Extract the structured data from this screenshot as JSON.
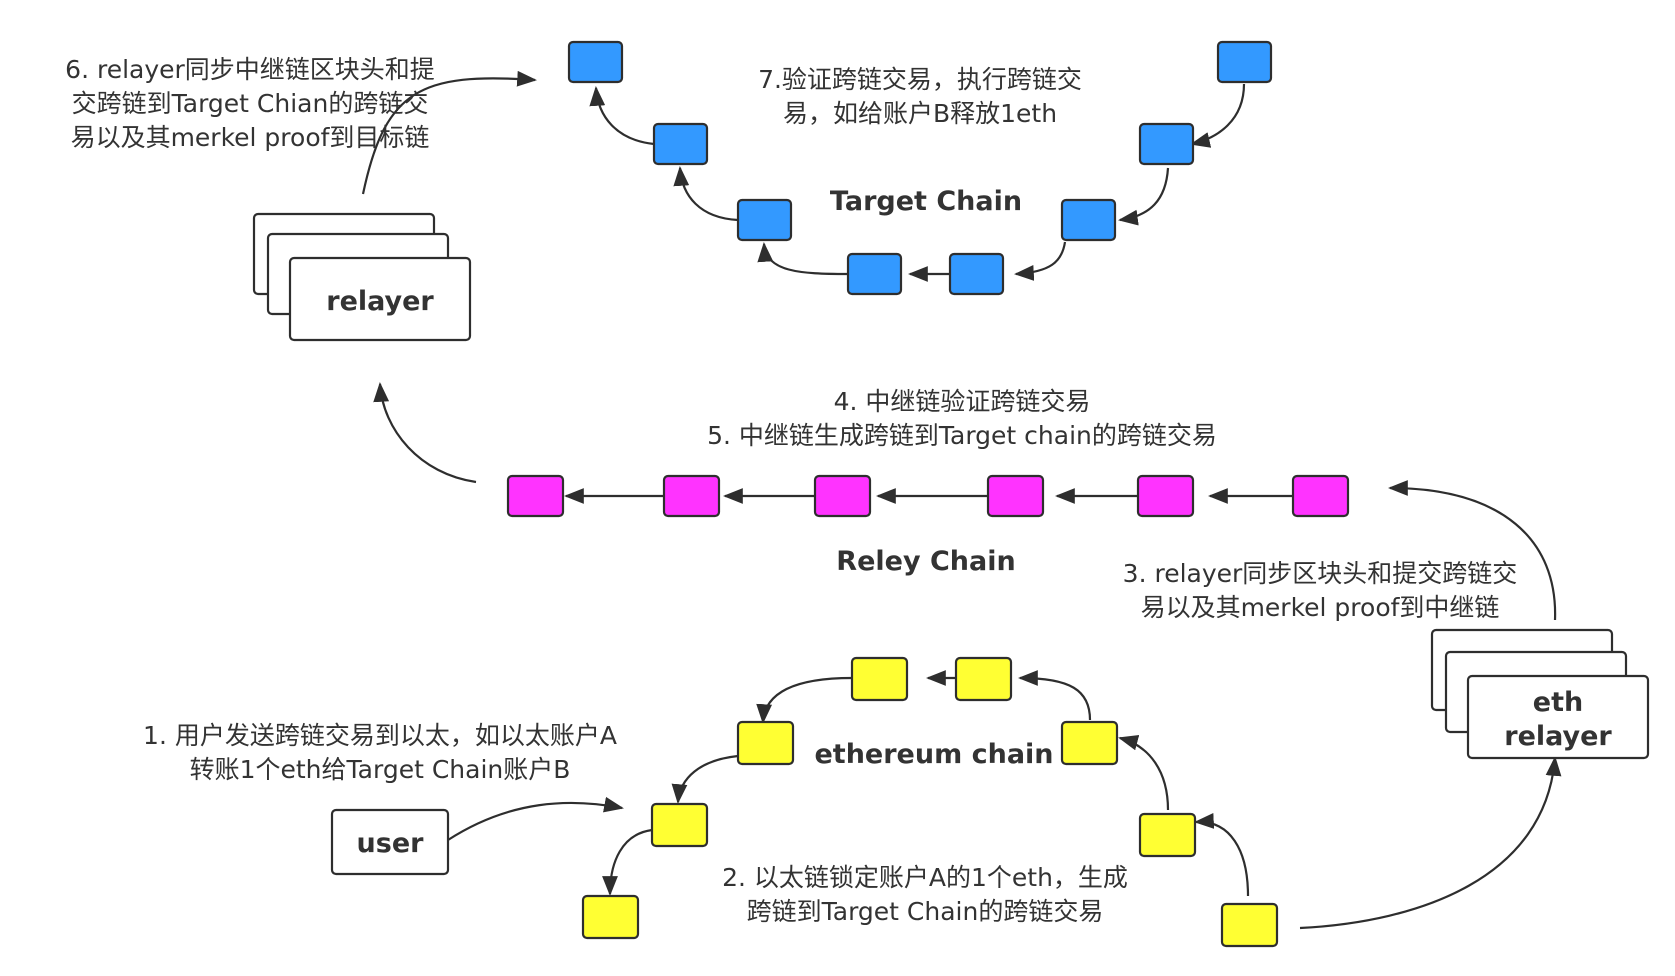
{
  "colors": {
    "target_block": "#3399FF",
    "relay_block": "#FF33FF",
    "eth_block": "#FFFF33",
    "stroke": "#2E2E2E",
    "text": "#333333"
  },
  "chains": {
    "target": {
      "name": "Target Chain"
    },
    "relay": {
      "name": "Reley Chain"
    },
    "eth": {
      "name": "ethereum chain"
    }
  },
  "nodes": {
    "relayer": "relayer",
    "eth_relayer": [
      "eth",
      "relayer"
    ],
    "user": "user"
  },
  "steps": {
    "step1": [
      "1. 用户发送跨链交易到以太，如以太账户A",
      "转账1个eth给Target Chain账户B"
    ],
    "step2": [
      "2. 以太链锁定账户A的1个eth，生成",
      "跨链到Target Chain的跨链交易"
    ],
    "step3": [
      "3. relayer同步区块头和提交跨链交",
      "易以及其merkel proof到中继链"
    ],
    "step45": [
      "4. 中继链验证跨链交易",
      "5. 中继链生成跨链到Target chain的跨链交易"
    ],
    "step6": [
      "6. relayer同步中继链区块头和提",
      "交跨链到Target Chian的跨链交",
      "易以及其merkel proof到目标链"
    ],
    "step7": [
      "7.验证跨链交易，执行跨链交",
      "易，如给账户B释放1eth"
    ]
  }
}
